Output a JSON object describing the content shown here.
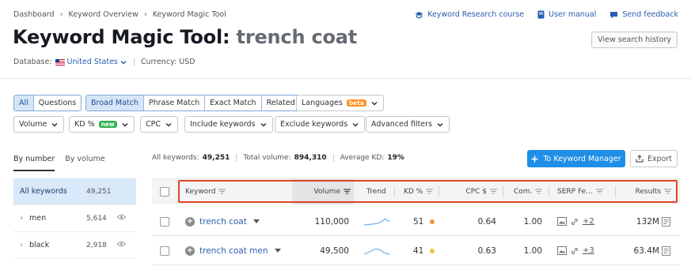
{
  "breadcrumb": [
    "Dashboard",
    "Keyword Overview",
    "Keyword Magic Tool"
  ],
  "top_links": {
    "course": "Keyword Research course",
    "manual": "User manual",
    "feedback": "Send feedback"
  },
  "title": {
    "tool": "Keyword Magic Tool:",
    "query": "trench coat"
  },
  "history_button": "View search history",
  "database": {
    "label": "Database:",
    "value": "United States",
    "currency": "Currency: USD"
  },
  "filters": {
    "all": "All",
    "questions": "Questions",
    "broad": "Broad Match",
    "phrase": "Phrase Match",
    "exact": "Exact Match",
    "related": "Related",
    "languages": "Languages",
    "beta": "beta",
    "volume": "Volume",
    "kd": "KD %",
    "new": "new",
    "cpc": "CPC",
    "include": "Include keywords",
    "exclude": "Exclude keywords",
    "advanced": "Advanced filters"
  },
  "tabs": {
    "by_number": "By number",
    "by_volume": "By volume"
  },
  "stats": {
    "all_keywords_label": "All keywords:",
    "all_keywords": "49,251",
    "total_volume_label": "Total volume:",
    "total_volume": "894,310",
    "avg_kd_label": "Average KD:",
    "avg_kd": "19%"
  },
  "buttons": {
    "manager": "To Keyword Manager",
    "export": "Export"
  },
  "groups": [
    {
      "label": "All keywords",
      "count": "49,251"
    },
    {
      "label": "men",
      "count": "5,614"
    },
    {
      "label": "black",
      "count": "2,918"
    }
  ],
  "table": {
    "headers": {
      "keyword": "Keyword",
      "volume": "Volume",
      "trend": "Trend",
      "kd": "KD %",
      "cpc": "CPC $",
      "com": "Com.",
      "serp": "SERP Fe...",
      "results": "Results"
    },
    "rows": [
      {
        "keyword": "trench coat",
        "volume": "110,000",
        "kd": "51",
        "cpc": "0.64",
        "com": "1.00",
        "serp_more": "+2",
        "results": "132M"
      },
      {
        "keyword": "trench coat men",
        "volume": "49,500",
        "kd": "41",
        "cpc": "0.63",
        "com": "1.00",
        "serp_more": "+3",
        "results": "63.4M"
      }
    ]
  },
  "colors": {
    "accent": "#1f8ee6",
    "highlight_box": "#e0451f",
    "kd_hard": "#f29339",
    "kd_medium": "#f5c33b",
    "trend": "#6fb1ea"
  }
}
